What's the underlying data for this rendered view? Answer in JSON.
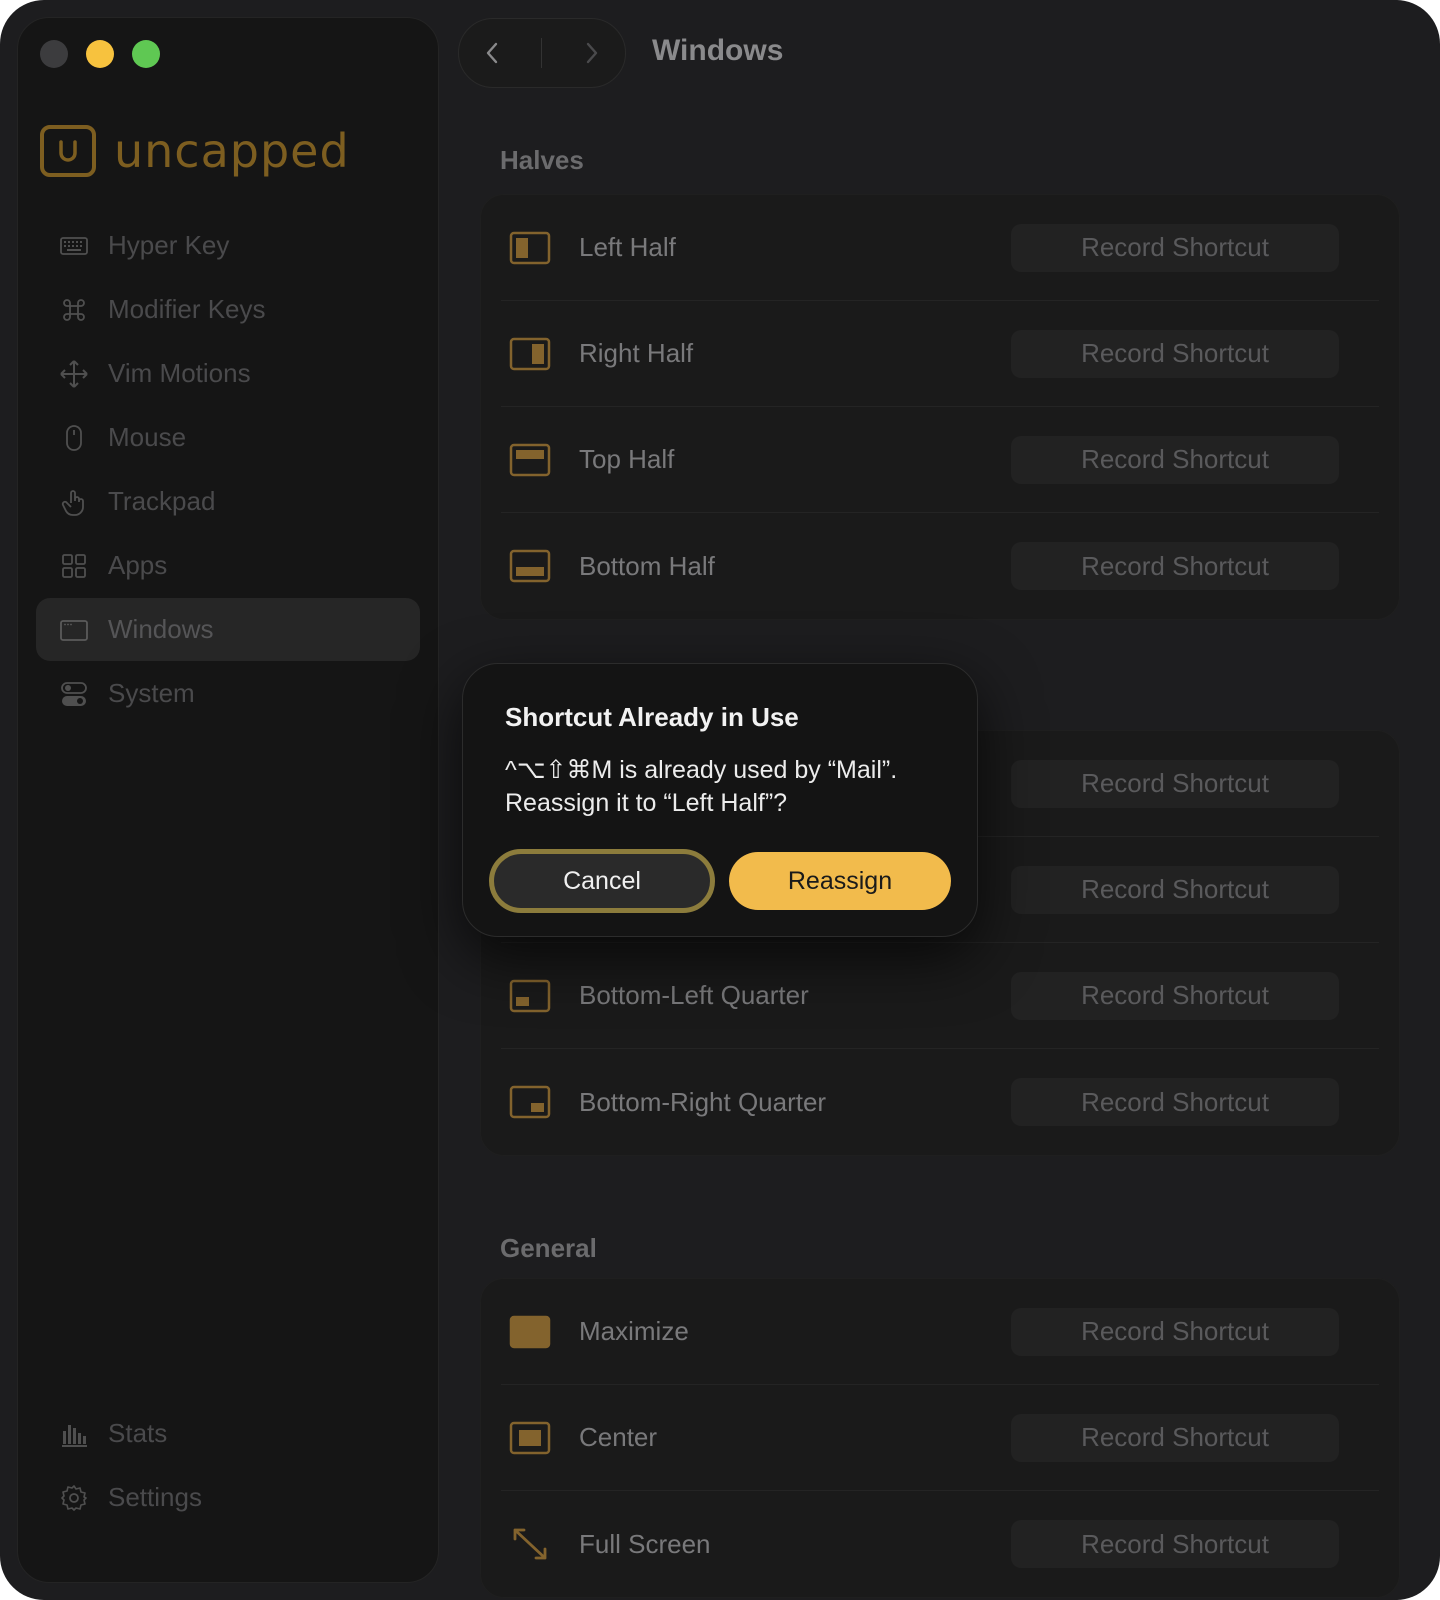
{
  "window": {
    "title": "Windows"
  },
  "app": {
    "name": "uncapped",
    "logo_letter": "u"
  },
  "sidebar": {
    "items": [
      {
        "label": "Hyper Key",
        "icon": "keyboard-icon"
      },
      {
        "label": "Modifier Keys",
        "icon": "command-icon"
      },
      {
        "label": "Vim Motions",
        "icon": "move-arrows-icon"
      },
      {
        "label": "Mouse",
        "icon": "mouse-icon"
      },
      {
        "label": "Trackpad",
        "icon": "hand-pointer-icon"
      },
      {
        "label": "Apps",
        "icon": "apps-grid-icon"
      },
      {
        "label": "Windows",
        "icon": "window-icon",
        "active": true
      },
      {
        "label": "System",
        "icon": "toggles-icon"
      }
    ],
    "bottom_items": [
      {
        "label": "Stats",
        "icon": "bar-chart-icon"
      },
      {
        "label": "Settings",
        "icon": "gear-icon"
      }
    ]
  },
  "sections": {
    "halves": {
      "title": "Halves",
      "rows": [
        {
          "label": "Left Half",
          "button": "Record Shortcut"
        },
        {
          "label": "Right Half",
          "button": "Record Shortcut"
        },
        {
          "label": "Top Half",
          "button": "Record Shortcut"
        },
        {
          "label": "Bottom Half",
          "button": "Record Shortcut"
        }
      ]
    },
    "quarters": {
      "rows": [
        {
          "label": "",
          "button": "Record Shortcut"
        },
        {
          "label": "",
          "button": "Record Shortcut"
        },
        {
          "label": "Bottom-Left Quarter",
          "button": "Record Shortcut"
        },
        {
          "label": "Bottom-Right Quarter",
          "button": "Record Shortcut"
        }
      ]
    },
    "general": {
      "title": "General",
      "rows": [
        {
          "label": "Maximize",
          "button": "Record Shortcut"
        },
        {
          "label": "Center",
          "button": "Record Shortcut"
        },
        {
          "label": "Full Screen",
          "button": "Record Shortcut"
        }
      ]
    }
  },
  "dialog": {
    "title": "Shortcut Already in Use",
    "message_line1": "^⌥⇧⌘M is already used by “Mail”.",
    "message_line2": "Reassign it to “Left Half”?",
    "cancel_label": "Cancel",
    "confirm_label": "Reassign"
  },
  "colors": {
    "accent": "#f2bb4c",
    "icon_accent": "#c9943a",
    "background": "#1d1d1f",
    "sidebar": "#151515"
  }
}
